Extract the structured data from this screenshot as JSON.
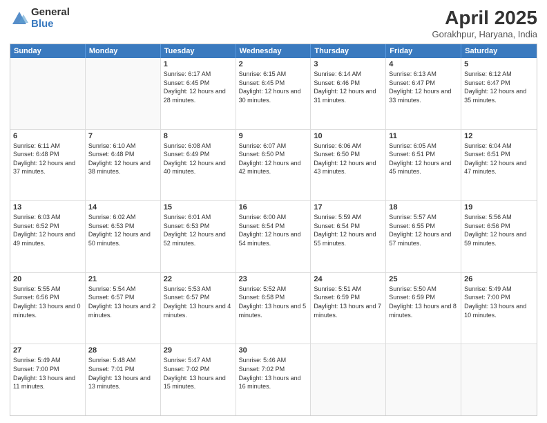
{
  "logo": {
    "general": "General",
    "blue": "Blue"
  },
  "title": "April 2025",
  "subtitle": "Gorakhpur, Haryana, India",
  "days": [
    "Sunday",
    "Monday",
    "Tuesday",
    "Wednesday",
    "Thursday",
    "Friday",
    "Saturday"
  ],
  "weeks": [
    [
      {
        "day": "",
        "sunrise": "",
        "sunset": "",
        "daylight": ""
      },
      {
        "day": "",
        "sunrise": "",
        "sunset": "",
        "daylight": ""
      },
      {
        "day": "1",
        "sunrise": "Sunrise: 6:17 AM",
        "sunset": "Sunset: 6:45 PM",
        "daylight": "Daylight: 12 hours and 28 minutes."
      },
      {
        "day": "2",
        "sunrise": "Sunrise: 6:15 AM",
        "sunset": "Sunset: 6:45 PM",
        "daylight": "Daylight: 12 hours and 30 minutes."
      },
      {
        "day": "3",
        "sunrise": "Sunrise: 6:14 AM",
        "sunset": "Sunset: 6:46 PM",
        "daylight": "Daylight: 12 hours and 31 minutes."
      },
      {
        "day": "4",
        "sunrise": "Sunrise: 6:13 AM",
        "sunset": "Sunset: 6:47 PM",
        "daylight": "Daylight: 12 hours and 33 minutes."
      },
      {
        "day": "5",
        "sunrise": "Sunrise: 6:12 AM",
        "sunset": "Sunset: 6:47 PM",
        "daylight": "Daylight: 12 hours and 35 minutes."
      }
    ],
    [
      {
        "day": "6",
        "sunrise": "Sunrise: 6:11 AM",
        "sunset": "Sunset: 6:48 PM",
        "daylight": "Daylight: 12 hours and 37 minutes."
      },
      {
        "day": "7",
        "sunrise": "Sunrise: 6:10 AM",
        "sunset": "Sunset: 6:48 PM",
        "daylight": "Daylight: 12 hours and 38 minutes."
      },
      {
        "day": "8",
        "sunrise": "Sunrise: 6:08 AM",
        "sunset": "Sunset: 6:49 PM",
        "daylight": "Daylight: 12 hours and 40 minutes."
      },
      {
        "day": "9",
        "sunrise": "Sunrise: 6:07 AM",
        "sunset": "Sunset: 6:50 PM",
        "daylight": "Daylight: 12 hours and 42 minutes."
      },
      {
        "day": "10",
        "sunrise": "Sunrise: 6:06 AM",
        "sunset": "Sunset: 6:50 PM",
        "daylight": "Daylight: 12 hours and 43 minutes."
      },
      {
        "day": "11",
        "sunrise": "Sunrise: 6:05 AM",
        "sunset": "Sunset: 6:51 PM",
        "daylight": "Daylight: 12 hours and 45 minutes."
      },
      {
        "day": "12",
        "sunrise": "Sunrise: 6:04 AM",
        "sunset": "Sunset: 6:51 PM",
        "daylight": "Daylight: 12 hours and 47 minutes."
      }
    ],
    [
      {
        "day": "13",
        "sunrise": "Sunrise: 6:03 AM",
        "sunset": "Sunset: 6:52 PM",
        "daylight": "Daylight: 12 hours and 49 minutes."
      },
      {
        "day": "14",
        "sunrise": "Sunrise: 6:02 AM",
        "sunset": "Sunset: 6:53 PM",
        "daylight": "Daylight: 12 hours and 50 minutes."
      },
      {
        "day": "15",
        "sunrise": "Sunrise: 6:01 AM",
        "sunset": "Sunset: 6:53 PM",
        "daylight": "Daylight: 12 hours and 52 minutes."
      },
      {
        "day": "16",
        "sunrise": "Sunrise: 6:00 AM",
        "sunset": "Sunset: 6:54 PM",
        "daylight": "Daylight: 12 hours and 54 minutes."
      },
      {
        "day": "17",
        "sunrise": "Sunrise: 5:59 AM",
        "sunset": "Sunset: 6:54 PM",
        "daylight": "Daylight: 12 hours and 55 minutes."
      },
      {
        "day": "18",
        "sunrise": "Sunrise: 5:57 AM",
        "sunset": "Sunset: 6:55 PM",
        "daylight": "Daylight: 12 hours and 57 minutes."
      },
      {
        "day": "19",
        "sunrise": "Sunrise: 5:56 AM",
        "sunset": "Sunset: 6:56 PM",
        "daylight": "Daylight: 12 hours and 59 minutes."
      }
    ],
    [
      {
        "day": "20",
        "sunrise": "Sunrise: 5:55 AM",
        "sunset": "Sunset: 6:56 PM",
        "daylight": "Daylight: 13 hours and 0 minutes."
      },
      {
        "day": "21",
        "sunrise": "Sunrise: 5:54 AM",
        "sunset": "Sunset: 6:57 PM",
        "daylight": "Daylight: 13 hours and 2 minutes."
      },
      {
        "day": "22",
        "sunrise": "Sunrise: 5:53 AM",
        "sunset": "Sunset: 6:57 PM",
        "daylight": "Daylight: 13 hours and 4 minutes."
      },
      {
        "day": "23",
        "sunrise": "Sunrise: 5:52 AM",
        "sunset": "Sunset: 6:58 PM",
        "daylight": "Daylight: 13 hours and 5 minutes."
      },
      {
        "day": "24",
        "sunrise": "Sunrise: 5:51 AM",
        "sunset": "Sunset: 6:59 PM",
        "daylight": "Daylight: 13 hours and 7 minutes."
      },
      {
        "day": "25",
        "sunrise": "Sunrise: 5:50 AM",
        "sunset": "Sunset: 6:59 PM",
        "daylight": "Daylight: 13 hours and 8 minutes."
      },
      {
        "day": "26",
        "sunrise": "Sunrise: 5:49 AM",
        "sunset": "Sunset: 7:00 PM",
        "daylight": "Daylight: 13 hours and 10 minutes."
      }
    ],
    [
      {
        "day": "27",
        "sunrise": "Sunrise: 5:49 AM",
        "sunset": "Sunset: 7:00 PM",
        "daylight": "Daylight: 13 hours and 11 minutes."
      },
      {
        "day": "28",
        "sunrise": "Sunrise: 5:48 AM",
        "sunset": "Sunset: 7:01 PM",
        "daylight": "Daylight: 13 hours and 13 minutes."
      },
      {
        "day": "29",
        "sunrise": "Sunrise: 5:47 AM",
        "sunset": "Sunset: 7:02 PM",
        "daylight": "Daylight: 13 hours and 15 minutes."
      },
      {
        "day": "30",
        "sunrise": "Sunrise: 5:46 AM",
        "sunset": "Sunset: 7:02 PM",
        "daylight": "Daylight: 13 hours and 16 minutes."
      },
      {
        "day": "",
        "sunrise": "",
        "sunset": "",
        "daylight": ""
      },
      {
        "day": "",
        "sunrise": "",
        "sunset": "",
        "daylight": ""
      },
      {
        "day": "",
        "sunrise": "",
        "sunset": "",
        "daylight": ""
      }
    ]
  ]
}
